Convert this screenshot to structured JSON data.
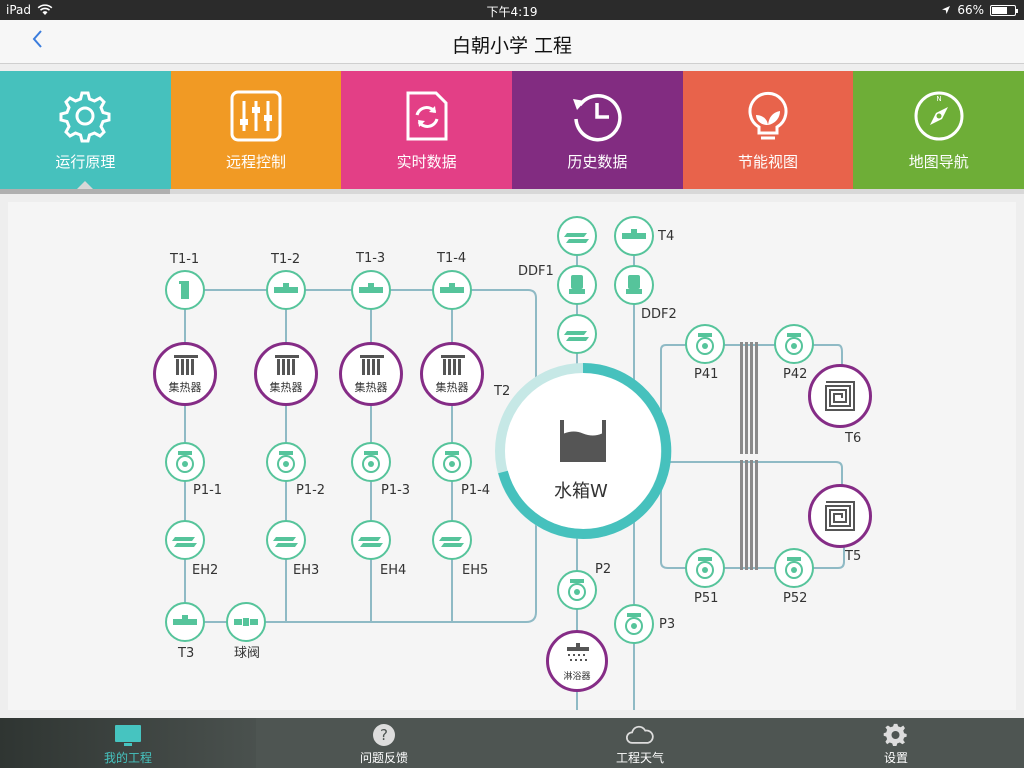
{
  "status_bar": {
    "device": "iPad",
    "time": "下午4:19",
    "battery": "66%",
    "battery_level": 0.66
  },
  "nav": {
    "title": "白朝小学 工程"
  },
  "tabs": [
    {
      "label": "运行原理",
      "color": "#46c1bd",
      "icon": "gear-icon"
    },
    {
      "label": "远程控制",
      "color": "#f19a24",
      "icon": "sliders-icon"
    },
    {
      "label": "实时数据",
      "color": "#e33f86",
      "icon": "refresh-document-icon"
    },
    {
      "label": "历史数据",
      "color": "#822c81",
      "icon": "history-clock-icon"
    },
    {
      "label": "节能视图",
      "color": "#e8634b",
      "icon": "leaf-bulb-icon"
    },
    {
      "label": "地图导航",
      "color": "#6eae37",
      "icon": "compass-icon"
    }
  ],
  "diagram": {
    "tank_label": "水箱W",
    "collector_label": "集热器",
    "shower_label": "淋浴器",
    "labels": {
      "T1-1": "T1-1",
      "T1-2": "T1-2",
      "T1-3": "T1-3",
      "T1-4": "T1-4",
      "P1-1": "P1-1",
      "P1-2": "P1-2",
      "P1-3": "P1-3",
      "P1-4": "P1-4",
      "EH2": "EH2",
      "EH3": "EH3",
      "EH4": "EH4",
      "EH5": "EH5",
      "T3": "T3",
      "ball_valve": "球阀",
      "T2": "T2",
      "DDF1": "DDF1",
      "DDF2": "DDF2",
      "T4": "T4",
      "P2": "P2",
      "P3": "P3",
      "P41": "P41",
      "P42": "P42",
      "P51": "P51",
      "P52": "P52",
      "T5": "T5",
      "T6": "T6"
    },
    "colors": {
      "pipe": "#8fbac5",
      "node_border": "#56c49b",
      "collector_border": "#852c86",
      "tank_ring": "#46c1bd",
      "tank_ring_light": "#c6e8e6"
    },
    "tank_level": 0.75
  },
  "bottom_tabs": [
    {
      "label": "我的工程",
      "icon": "monitor-icon",
      "active": true
    },
    {
      "label": "问题反馈",
      "icon": "question-icon",
      "active": false
    },
    {
      "label": "工程天气",
      "icon": "cloud-icon",
      "active": false
    },
    {
      "label": "设置",
      "icon": "settings-gear-icon",
      "active": false
    }
  ]
}
